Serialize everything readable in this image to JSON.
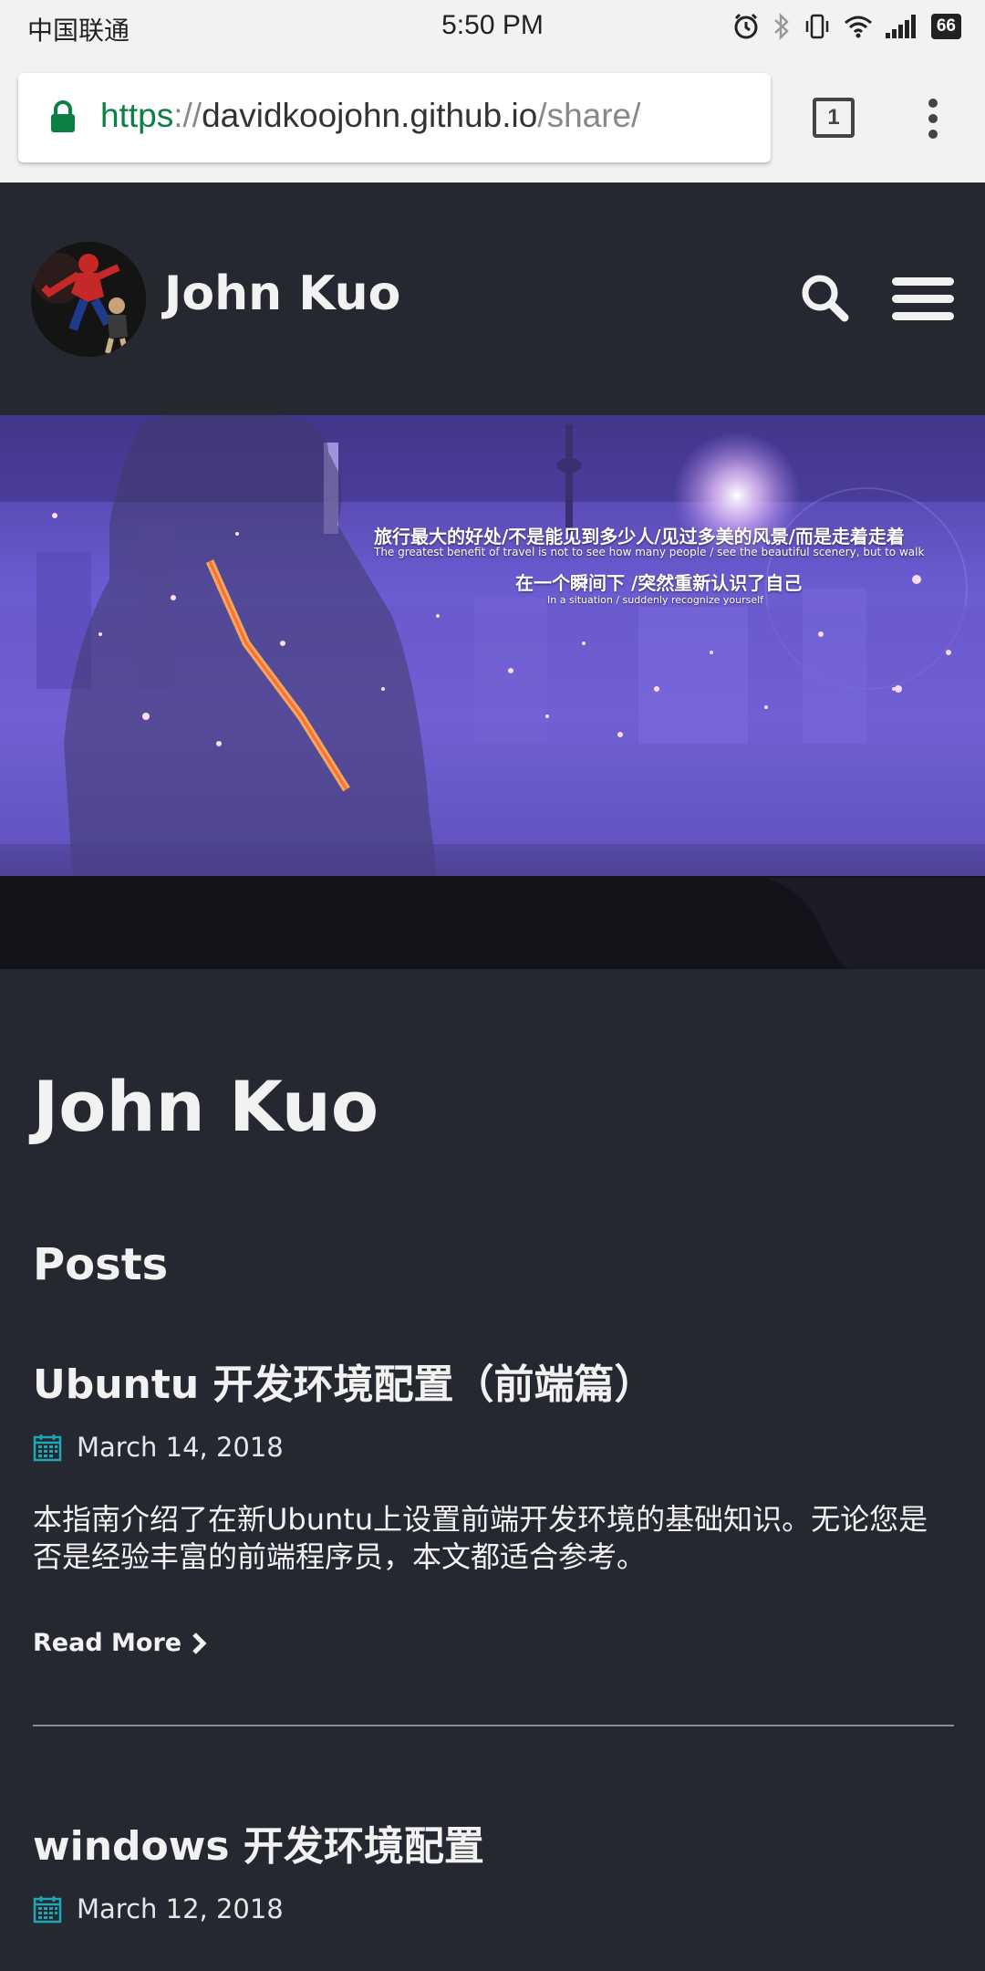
{
  "status_bar": {
    "carrier": "中国联通",
    "time": "5:50 PM",
    "battery": "66",
    "icons": [
      "alarm-icon",
      "bluetooth-icon",
      "vibrate-icon",
      "wifi-icon",
      "signal-icon",
      "battery-icon"
    ]
  },
  "browser": {
    "url_scheme": "https",
    "url_separator": "://",
    "url_host": "davidkoojohn.github.io",
    "url_path": "/share/",
    "tab_count": "1",
    "secure_color": "#0b8043"
  },
  "header": {
    "site_title": "John Kuo",
    "icons": [
      "avatar",
      "search-icon",
      "hamburger-menu-icon"
    ]
  },
  "hero": {
    "line_1": "旅行最大的好处/不是能见到多少人/见过多美的风景/而是走着走着",
    "line_2": "The greatest benefit of travel is not to see how many people / see the beautiful scenery, but to walk",
    "line_3": "在一个瞬间下 /突然重新认识了自己",
    "line_4": "In a situation / suddenly recognize yourself"
  },
  "main": {
    "page_title": "John Kuo",
    "section_title": "Posts",
    "read_more_label": "Read More",
    "posts": [
      {
        "title": "Ubuntu 开发环境配置（前端篇）",
        "date": "March 14, 2018",
        "excerpt": "本指南介绍了在新Ubuntu上设置前端开发环境的基础知识。无论您是否是经验丰富的前端程序员，本文都适合参考。"
      },
      {
        "title": "windows 开发环境配置",
        "date": "March 12, 2018"
      }
    ]
  },
  "colors": {
    "background": "#252830",
    "text": "#f2f2f2",
    "accent_calendar": "#1fa7b8",
    "chrome_bar": "#f2f2f2"
  }
}
